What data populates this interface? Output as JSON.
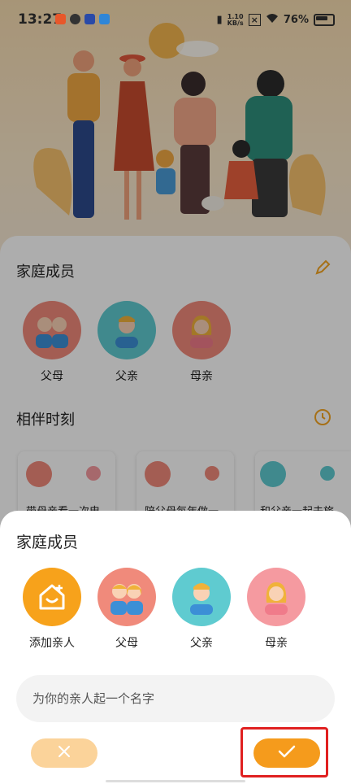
{
  "status_bar": {
    "time": "13:27",
    "net_speed_value": "1.10",
    "net_speed_unit": "KB/s",
    "battery": "76%"
  },
  "background": {
    "family_section": {
      "title": "家庭成员",
      "members": [
        {
          "label": "父母",
          "icon": "parents-avatar-icon",
          "color": "#f08a7b"
        },
        {
          "label": "父亲",
          "icon": "father-avatar-icon",
          "color": "#5fcbd0"
        },
        {
          "label": "母亲",
          "icon": "mother-avatar-icon",
          "color": "#f08a7b"
        }
      ]
    },
    "moments_section": {
      "title": "相伴时刻",
      "cards": [
        {
          "text": "带母亲看一次电"
        },
        {
          "text": "陪父母每年做一"
        },
        {
          "text": "和父亲一起去旅"
        }
      ]
    }
  },
  "sheet": {
    "title": "家庭成员",
    "options": [
      {
        "label": "添加亲人",
        "icon": "add-home-icon",
        "color": "#f7a21b"
      },
      {
        "label": "父母",
        "icon": "parents-avatar-icon",
        "color": "#f08a7b"
      },
      {
        "label": "父亲",
        "icon": "father-avatar-icon",
        "color": "#5fcbd0"
      },
      {
        "label": "母亲",
        "icon": "mother-avatar-icon",
        "color": "#f59aa0"
      }
    ],
    "name_placeholder": "为你的亲人起一个名字",
    "cancel_icon": "close-icon",
    "confirm_icon": "check-icon"
  },
  "colors": {
    "accent": "#f59b1c",
    "accent_light": "#fbd39a",
    "highlight": "#e02020"
  }
}
